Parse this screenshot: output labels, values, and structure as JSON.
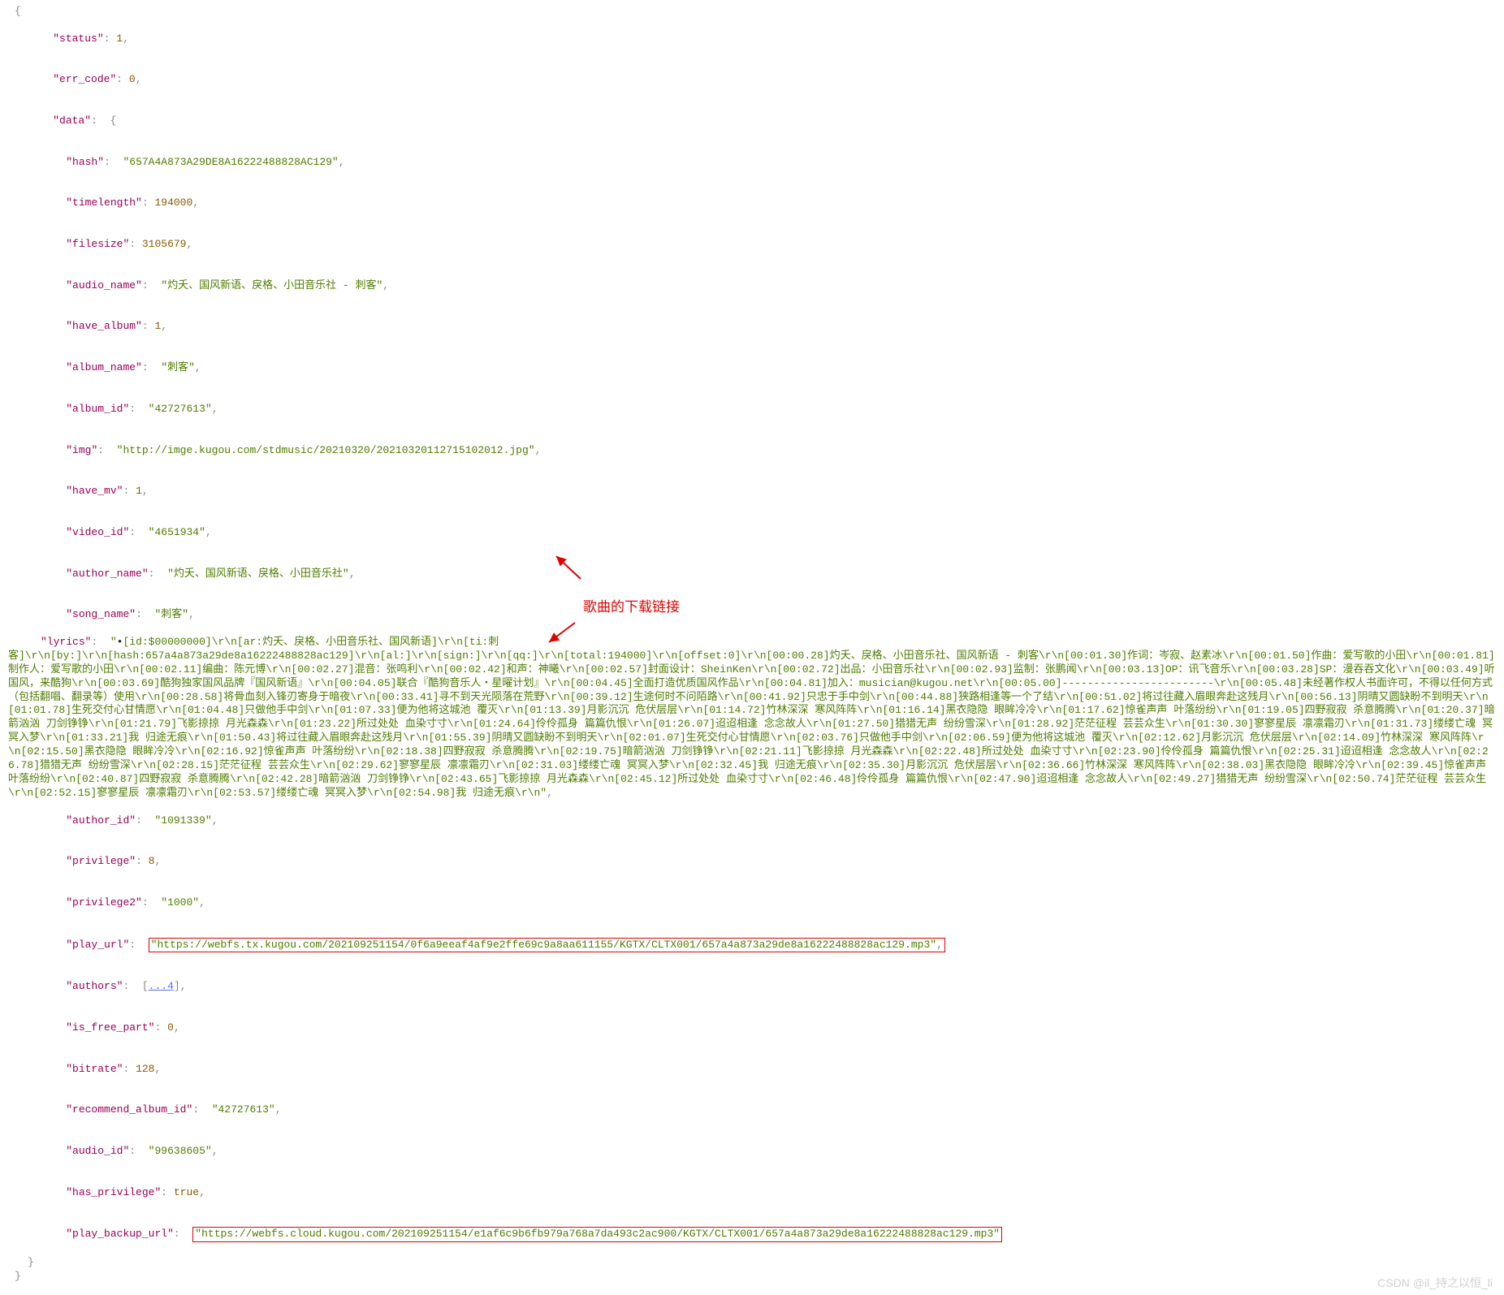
{
  "top_bullet": "•",
  "json": {
    "status": 1,
    "err_code": 0,
    "data_open": "{",
    "hash": "657A4A873A29DE8A16222488828AC129",
    "timelength": 194000,
    "filesize": 3105679,
    "audio_name": "灼夭、国风新语、戾格、小田音乐社 - 刺客",
    "have_album": 1,
    "album_name": "刺客",
    "album_id": "42727613",
    "img": "http://imge.kugou.com/stdmusic/20210320/20210320112715102012.jpg",
    "have_mv": 1,
    "video_id": "4651934",
    "author_name": "灼夭、国风新语、戾格、小田音乐社",
    "song_name": "刺客",
    "lyrics_head": "[id:$00000000]\\r\\n[ar:灼夭、戾格、小田音乐社、国风新语]\\r\\n[ti:刺",
    "lyrics_rest": "客]\\r\\n[by:]\\r\\n[hash:657a4a873a29de8a16222488828ac129]\\r\\n[al:]\\r\\n[sign:]\\r\\n[qq:]\\r\\n[total:194000]\\r\\n[offset:0]\\r\\n[00:00.28]灼夭、戾格、小田音乐社、国风新语 - 刺客\\r\\n[00:01.30]作词：岑寂、赵素冰\\r\\n[00:01.50]作曲：爱写歌的小田\\r\\n[00:01.81]制作人：爱写歌的小田\\r\\n[00:02.11]编曲：陈元博\\r\\n[00:02.27]混音：张鸣利\\r\\n[00:02.42]和声：神曦\\r\\n[00:02.57]封面设计：SheinKen\\r\\n[00:02.72]出品：小田音乐社\\r\\n[00:02.93]监制：张鹏闻\\r\\n[00:03.13]OP：讯飞音乐\\r\\n[00:03.28]SP：漫吞吞文化\\r\\n[00:03.49]听国风，来酷狗\\r\\n[00:03.69]酷狗独家国风品牌『国风新语』\\r\\n[00:04.05]联合『酷狗音乐人・星曜计划』\\r\\n[00:04.45]全面打造优质国风作品\\r\\n[00:04.81]加入：musician@kugou.net\\r\\n[00:05.00]------------------------\\r\\n[00:05.48]未经著作权人书面许可，不得以任何方式（包括翻唱、翻录等）使用\\r\\n[00:28.58]将骨血刻入锋刃寄身于暗夜\\r\\n[00:33.41]寻不到天光陨落在荒野\\r\\n[00:39.12]生途何时不问陌路\\r\\n[00:41.92]只忠于手中剑\\r\\n[00:44.88]狭路相逢等一个了结\\r\\n[00:51.02]将过往藏入眉眼奔赴这残月\\r\\n[00:56.13]阴晴又圆缺盼不到明天\\r\\n[01:01.78]生死交付心甘情愿\\r\\n[01:04.48]只做他手中剑\\r\\n[01:07.33]便为他将这城池 覆灭\\r\\n[01:13.39]月影沉沉 危伏层层\\r\\n[01:14.72]竹林深深 寒风阵阵\\r\\n[01:16.14]黑衣隐隐 眼眸冷冷\\r\\n[01:17.62]惊雀声声 叶落纷纷\\r\\n[01:19.05]四野寂寂 杀意腾腾\\r\\n[01:20.37]暗箭汹汹 刀剑铮铮\\r\\n[01:21.79]飞影掠掠 月光森森\\r\\n[01:23.22]所过处处 血染寸寸\\r\\n[01:24.64]伶伶孤身 篇篇仇恨\\r\\n[01:26.07]迢迢相逢 念念故人\\r\\n[01:27.50]猎猎无声 纷纷雪深\\r\\n[01:28.92]茫茫征程 芸芸众生\\r\\n[01:30.30]寥寥星辰 凛凛霜刃\\r\\n[01:31.73]缕缕亡魂 冥冥入梦\\r\\n[01:33.21]我 归途无痕\\r\\n[01:50.43]将过往藏入眉眼奔赴这残月\\r\\n[01:55.39]阴晴又圆缺盼不到明天\\r\\n[02:01.07]生死交付心甘情愿\\r\\n[02:03.76]只做他手中剑\\r\\n[02:06.59]便为他将这城池 覆灭\\r\\n[02:12.62]月影沉沉 危伏层层\\r\\n[02:14.09]竹林深深 寒风阵阵\\r\\n[02:15.50]黑衣隐隐 眼眸冷冷\\r\\n[02:16.92]惊雀声声 叶落纷纷\\r\\n[02:18.38]四野寂寂 杀意腾腾\\r\\n[02:19.75]暗箭汹汹 刀剑铮铮\\r\\n[02:21.11]飞影掠掠 月光森森\\r\\n[02:22.48]所过处处 血染寸寸\\r\\n[02:23.90]伶伶孤身 篇篇仇恨\\r\\n[02:25.31]迢迢相逢 念念故人\\r\\n[02:26.78]猎猎无声 纷纷雪深\\r\\n[02:28.15]茫茫征程 芸芸众生\\r\\n[02:29.62]寥寥星辰 凛凛霜刃\\r\\n[02:31.03]缕缕亡魂 冥冥入梦\\r\\n[02:32.45]我 归途无痕\\r\\n[02:35.30]月影沉沉 危伏层层\\r\\n[02:36.66]竹林深深 寒风阵阵\\r\\n[02:38.03]黑衣隐隐 眼眸冷冷\\r\\n[02:39.45]惊雀声声 叶落纷纷\\r\\n[02:40.87]四野寂寂 杀意腾腾\\r\\n[02:42.28]暗箭汹汹 刀剑铮铮\\r\\n[02:43.65]飞影掠掠 月光森森\\r\\n[02:45.12]所过处处 血染寸寸\\r\\n[02:46.48]伶伶孤身 篇篇仇恨\\r\\n[02:47.90]迢迢相逢 念念故人\\r\\n[02:49.27]猎猎无声 纷纷雪深\\r\\n[02:50.74]茫茫征程 芸芸众生\\r\\n[02:52.15]寥寥星辰 凛凛霜刃\\r\\n[02:53.57]缕缕亡魂 冥冥入梦\\r\\n[02:54.98]我 归途无痕\\r\\n",
    "author_id": "1091339",
    "privilege": 8,
    "privilege2": "1000",
    "play_url": "https://webfs.tx.kugou.com/202109251154/0f6a9eeaf4af9e2ffe69c9a8aa611155/KGTX/CLTX001/657a4a873a29de8a16222488828ac129.mp3",
    "authors_collapsed": "...4",
    "is_free_part": 0,
    "bitrate": 128,
    "recommend_album_id": "42727613",
    "audio_id": "99638605",
    "has_privilege": "true",
    "play_backup_url": "https://webfs.cloud.kugou.com/202109251154/e1af6c9b6fb979a768a7da493c2ac900/KGTX/CLTX001/657a4a873a29de8a16222488828ac129.mp3"
  },
  "annotation": "歌曲的下载链接",
  "watermark": "CSDN @il_持之以恒_li"
}
